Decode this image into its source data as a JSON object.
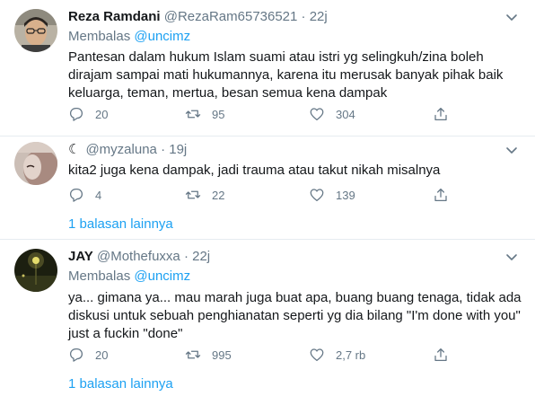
{
  "tweets": [
    {
      "name": "Reza Ramdani",
      "handle": "@RezaRam65736521",
      "sep": "·",
      "time": "22j",
      "reply_prefix": "Membalas",
      "reply_mention": "@uncimz",
      "text": "Pantesan dalam hukum Islam suami atau istri yg selingkuh/zina boleh dirajam sampai mati hukumannya, karena itu merusak banyak pihak baik keluarga, teman, mertua, besan semua kena dampak",
      "replies": "20",
      "retweets": "95",
      "likes": "304"
    },
    {
      "moon": "☾",
      "handle": "@myzaluna",
      "sep": "·",
      "time": "19j",
      "text": "kita2 juga kena dampak, jadi trauma atau takut nikah misalnya",
      "replies": "4",
      "retweets": "22",
      "likes": "139"
    },
    {
      "name": "JAY",
      "handle": "@Mothefuxxa",
      "sep": "·",
      "time": "22j",
      "reply_prefix": "Membalas",
      "reply_mention": "@uncimz",
      "text": "ya... gimana ya... mau marah juga buat apa, buang buang tenaga, tidak ada diskusi untuk sebuah penghianatan seperti yg dia bilang \"I'm done with you\" just a fuckin \"done\"",
      "replies": "20",
      "retweets": "995",
      "likes": "2,7 rb"
    }
  ],
  "more_replies_label": "1 balasan lainnya",
  "colors": {
    "accent": "#1da1f2",
    "secondary_text": "#657786",
    "divider": "#e6ecf0"
  },
  "icons": [
    "reply-icon",
    "retweet-icon",
    "like-icon",
    "share-icon",
    "caret-down-icon"
  ]
}
